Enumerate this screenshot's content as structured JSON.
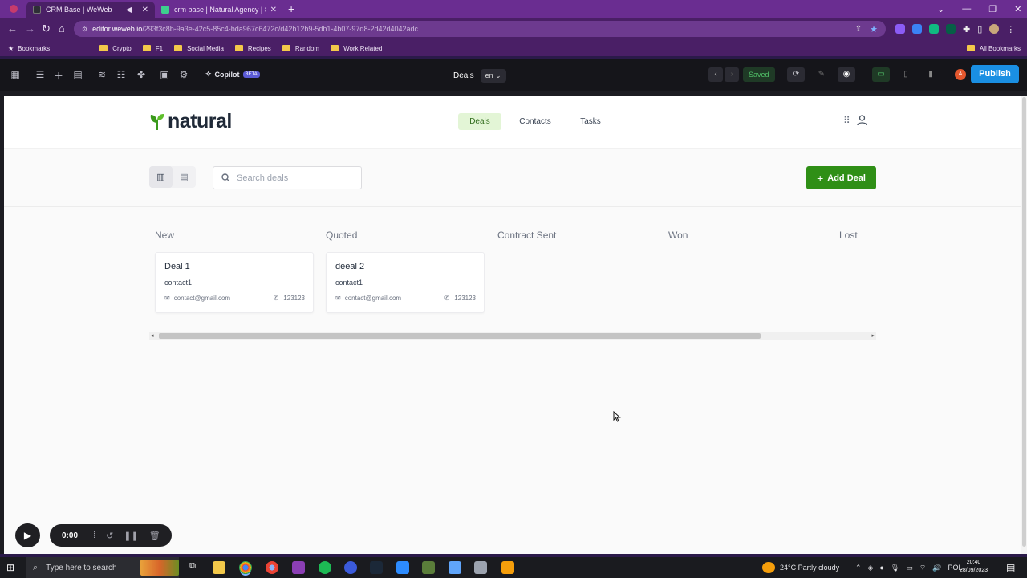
{
  "browser": {
    "tabs": [
      {
        "title": "CRM Base | WeWeb",
        "favicon_color": "#2e2e36",
        "active": true
      },
      {
        "title": "crm base | Natural Agency | Sup",
        "favicon_color": "#3ecf8e",
        "active": false
      }
    ],
    "new_tab_label": "+",
    "url_host": "editor.weweb.io",
    "url_path": "/293f3c8b-9a3e-42c5-85c4-bda967c6472c/d42b12b9-5db1-4b07-97d8-2d42d4042adc",
    "bookmarks": [
      "Bookmarks",
      "Crypto",
      "F1",
      "Social Media",
      "Recipes",
      "Random",
      "Work Related"
    ],
    "all_bookmarks": "All Bookmarks"
  },
  "weweb": {
    "copilot_label": "Copilot",
    "beta_label": "BETA",
    "page_name": "Deals",
    "language": "en",
    "saved_label": "Saved",
    "avatar_initial": "A",
    "publish_label": "Publish"
  },
  "app": {
    "logo_text": "natural",
    "nav": [
      {
        "label": "Deals",
        "active": true
      },
      {
        "label": "Contacts",
        "active": false
      },
      {
        "label": "Tasks",
        "active": false
      }
    ],
    "search_placeholder": "Search deals",
    "add_deal_label": "Add Deal",
    "columns": [
      "New",
      "Quoted",
      "Contract Sent",
      "Won",
      "Lost"
    ],
    "cards": [
      {
        "column": "New",
        "title": "Deal 1",
        "contact": "contact1",
        "email": "contact@gmail.com",
        "phone": "123123"
      },
      {
        "column": "Quoted",
        "title": "deeal 2",
        "contact": "contact1",
        "email": "contact@gmail.com",
        "phone": "123123"
      }
    ],
    "accent_color": "#2f8f16"
  },
  "recorder": {
    "time": "0:00"
  },
  "taskbar": {
    "search_placeholder": "Type here to search",
    "weather": "24°C  Partly cloudy",
    "lang": "POL",
    "time": "20:40",
    "date": "28/09/2023"
  }
}
